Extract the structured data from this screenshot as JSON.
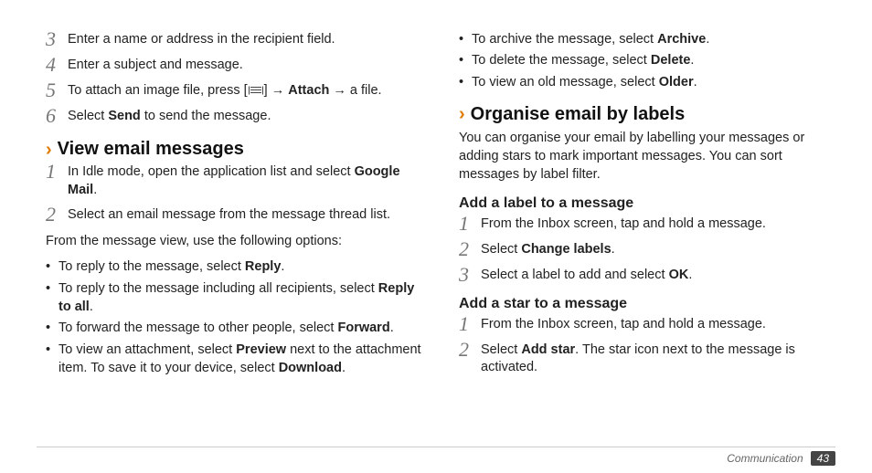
{
  "left": {
    "step3": "Enter a name or address in the recipient field.",
    "step4": "Enter a subject and message.",
    "step5_pre": "To attach an image file, press [",
    "step5_mid1": "] → ",
    "step5_attach": "Attach",
    "step5_post": " → a file.",
    "step6_pre": "Select ",
    "step6_send": "Send",
    "step6_post": " to send the message.",
    "h2_view": "View email messages",
    "s1_pre": "In Idle mode, open the application list and select ",
    "s1_app": "Google Mail",
    "s1_post": ".",
    "s2": "Select an email message from the message thread list.",
    "options_intro": "From the message view, use the following options:",
    "b_reply_pre": "To reply to the message, select ",
    "b_reply": "Reply",
    "b_reply_post": ".",
    "b_replyall_pre": "To reply to the message including all recipients, select ",
    "b_replyall": "Reply to all",
    "b_replyall_post": ".",
    "b_fwd_pre": "To forward the message to other people, select ",
    "b_fwd": "Forward",
    "b_fwd_post": ".",
    "b_att_pre": "To view an attachment, select ",
    "b_att_preview": "Preview",
    "b_att_mid": " next to the attachment item. To save it to your device, select ",
    "b_att_download": "Download",
    "b_att_post": "."
  },
  "right": {
    "b_arch_pre": "To archive the message, select ",
    "b_arch": "Archive",
    "b_arch_post": ".",
    "b_del_pre": "To delete the message, select ",
    "b_del": "Delete",
    "b_del_post": ".",
    "b_old_pre": "To view an old message, select ",
    "b_old": "Older",
    "b_old_post": ".",
    "h2_org": "Organise email by labels",
    "org_para": "You can organise your email by labelling your messages or adding stars to mark important messages. You can sort messages by label filter.",
    "h3_addlabel": "Add a label to a message",
    "al1": "From the Inbox screen, tap and hold a message.",
    "al2_pre": "Select ",
    "al2_bold": "Change labels",
    "al2_post": ".",
    "al3_pre": "Select a label to add and select ",
    "al3_bold": "OK",
    "al3_post": ".",
    "h3_addstar": "Add a star to a message",
    "as1": "From the Inbox screen, tap and hold a message.",
    "as2_pre": "Select ",
    "as2_bold": "Add star",
    "as2_post": ". The star icon next to the message is activated."
  },
  "footer": {
    "section": "Communication",
    "page": "43"
  }
}
